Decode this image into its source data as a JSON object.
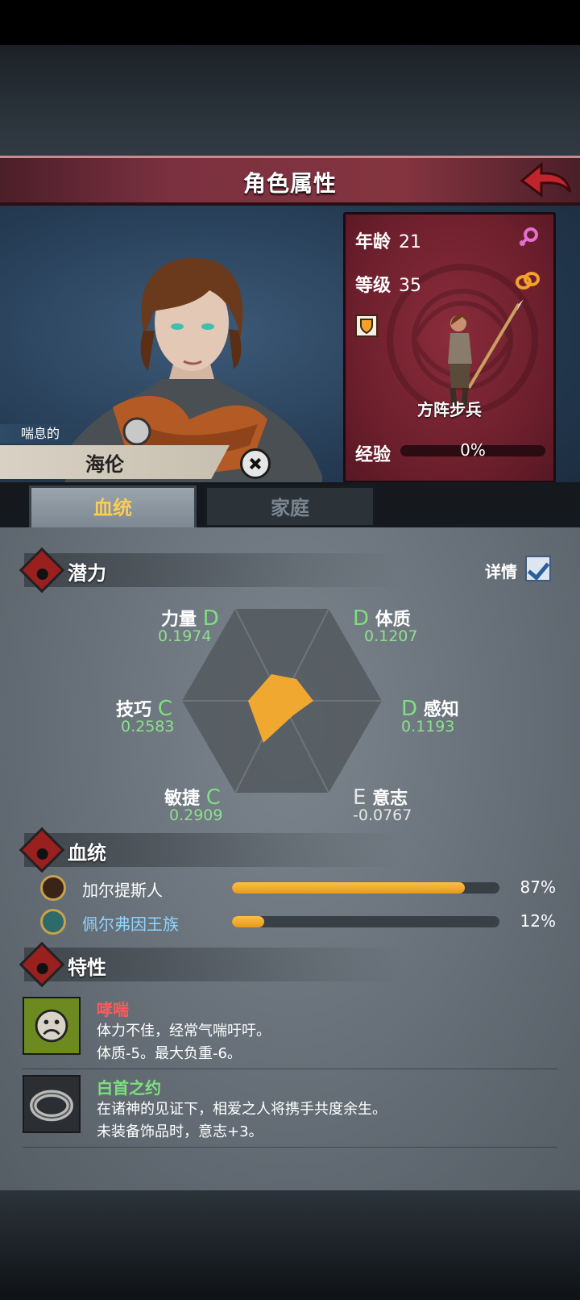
{
  "header": {
    "title": "角色属性"
  },
  "hero": {
    "mood": "喘息的",
    "name": "海伦",
    "age_label": "年龄",
    "age": "21",
    "level_label": "等级",
    "level": "35",
    "unit": "方阵步兵",
    "exp_label": "经验",
    "exp": "0%"
  },
  "tabs": [
    {
      "label": "血统",
      "active": true
    },
    {
      "label": "家庭",
      "active": false
    }
  ],
  "potential": {
    "title": "潜力",
    "detail_label": "详情",
    "attributes": [
      {
        "name": "力量",
        "grade": "D",
        "value": "0.1974"
      },
      {
        "name": "体质",
        "grade": "D",
        "value": "0.1207"
      },
      {
        "name": "技巧",
        "grade": "C",
        "value": "0.2583"
      },
      {
        "name": "感知",
        "grade": "D",
        "value": "0.1193"
      },
      {
        "name": "敏捷",
        "grade": "C",
        "value": "0.2909"
      },
      {
        "name": "意志",
        "grade": "E",
        "value": "-0.0767"
      }
    ]
  },
  "bloodline": {
    "title": "血统",
    "items": [
      {
        "name": "加尔提斯人",
        "percent": "87%",
        "fill": 0.87,
        "color": "#ffffff"
      },
      {
        "name": "佩尔弗因王族",
        "percent": "12%",
        "fill": 0.12,
        "color": "#8fd4ff"
      }
    ]
  },
  "traits": {
    "title": "特性",
    "items": [
      {
        "name": "哮喘",
        "color": "#ff5a5a",
        "line1": "体力不佳，经常气喘吁吁。",
        "line2": "体质-5。最大负重-6。"
      },
      {
        "name": "白首之约",
        "color": "#7ee07e",
        "line1": "在诸神的见证下，相爱之人将携手共度余生。",
        "line2": "未装备饰品时，意志+3。"
      }
    ]
  },
  "colors": {
    "accent": "#ffcc55",
    "banner": "#83343f",
    "card": "#6a1e2b",
    "radar_fill": "#f0a830"
  }
}
